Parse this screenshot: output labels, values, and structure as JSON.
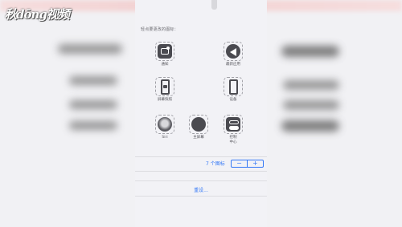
{
  "watermark": {
    "text": "秋dōng视频"
  },
  "panel": {
    "hint": "轻点要更改的图标：",
    "items": [
      {
        "label": "通知",
        "icon": "notification-icon"
      },
      {
        "label": "最新应用",
        "icon": "back-arrow-icon"
      },
      {
        "label": "屏幕快照",
        "icon": "screenshot-phone-icon"
      },
      {
        "label": "设备",
        "icon": "device-phone-icon"
      },
      {
        "label": "Siri",
        "icon": "siri-icon"
      },
      {
        "label": "主屏幕",
        "icon": "home-button-icon"
      },
      {
        "label": "控制\n中心",
        "icon": "control-center-icon"
      }
    ],
    "count_text": "7 个图标",
    "minus": "−",
    "plus": "+",
    "reset": "重设..."
  },
  "colors": {
    "accent": "#3478f6",
    "icon_dark": "#4a4a50",
    "panel_bg": "#f2f2f6"
  }
}
